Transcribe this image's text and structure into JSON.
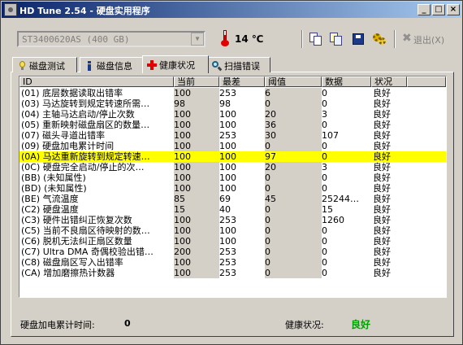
{
  "window": {
    "title": "HD Tune 2.54 - 硬盘实用程序",
    "minimize": "_",
    "maximize": "□",
    "close": "×"
  },
  "toolbar": {
    "drive": "ST3400620AS (400 GB)",
    "temperature": "14 ℃",
    "exit_label": "退出(X)"
  },
  "tabs": [
    {
      "label": "磁盘测试",
      "icon": "lightbulb-icon"
    },
    {
      "label": "磁盘信息",
      "icon": "info-icon"
    },
    {
      "label": "健康状况",
      "icon": "red-cross-icon",
      "active": true
    },
    {
      "label": "扫描错误",
      "icon": "magnifier-icon"
    }
  ],
  "table": {
    "columns": [
      "ID",
      "当前",
      "最差",
      "阈值",
      "数据",
      "状况"
    ],
    "rows": [
      {
        "id": "(01) 底层数据读取出错率",
        "cur": "100",
        "worst": "253",
        "thr": "6",
        "data": "0",
        "status": "良好"
      },
      {
        "id": "(03) 马达旋转到规定转速所需…",
        "cur": "98",
        "worst": "98",
        "thr": "0",
        "data": "0",
        "status": "良好"
      },
      {
        "id": "(04) 主轴马达启动/停止次数",
        "cur": "100",
        "worst": "100",
        "thr": "20",
        "data": "3",
        "status": "良好"
      },
      {
        "id": "(05) 重新映射磁盘扇区的数量…",
        "cur": "100",
        "worst": "100",
        "thr": "36",
        "data": "0",
        "status": "良好"
      },
      {
        "id": "(07) 磁头寻道出错率",
        "cur": "100",
        "worst": "253",
        "thr": "30",
        "data": "107",
        "status": "良好"
      },
      {
        "id": "(09) 硬盘加电累计时间",
        "cur": "100",
        "worst": "100",
        "thr": "0",
        "data": "0",
        "status": "良好"
      },
      {
        "id": "(0A) 马达重新旋转到规定转速…",
        "cur": "100",
        "worst": "100",
        "thr": "97",
        "data": "0",
        "status": "良好",
        "selected": true
      },
      {
        "id": "(0C) 硬盘完全启动/停止的次…",
        "cur": "100",
        "worst": "100",
        "thr": "20",
        "data": "3",
        "status": "良好"
      },
      {
        "id": "(BB) (未知属性)",
        "cur": "100",
        "worst": "100",
        "thr": "0",
        "data": "0",
        "status": "良好"
      },
      {
        "id": "(BD) (未知属性)",
        "cur": "100",
        "worst": "100",
        "thr": "0",
        "data": "0",
        "status": "良好"
      },
      {
        "id": "(BE) 气流温度",
        "cur": "85",
        "worst": "69",
        "thr": "45",
        "data": "25244…",
        "status": "良好"
      },
      {
        "id": "(C2) 硬盘温度",
        "cur": "15",
        "worst": "40",
        "thr": "0",
        "data": "15",
        "status": "良好"
      },
      {
        "id": "(C3) 硬件出错纠正恢复次数",
        "cur": "100",
        "worst": "253",
        "thr": "0",
        "data": "1260",
        "status": "良好"
      },
      {
        "id": "(C5) 当前不良扇区待映射的数…",
        "cur": "100",
        "worst": "100",
        "thr": "0",
        "data": "0",
        "status": "良好"
      },
      {
        "id": "(C6) 脱机无法纠正扇区数量",
        "cur": "100",
        "worst": "100",
        "thr": "0",
        "data": "0",
        "status": "良好"
      },
      {
        "id": "(C7) Ultra DMA 奇偶校验出错…",
        "cur": "200",
        "worst": "253",
        "thr": "0",
        "data": "0",
        "status": "良好"
      },
      {
        "id": "(C8) 磁盘扇区写入出错率",
        "cur": "100",
        "worst": "253",
        "thr": "0",
        "data": "0",
        "status": "良好"
      },
      {
        "id": "(CA) 增加磨擦热计数器",
        "cur": "100",
        "worst": "253",
        "thr": "0",
        "data": "0",
        "status": "良好"
      }
    ]
  },
  "footer": {
    "power_on_label": "硬盘加电累计时间:",
    "power_on_value": "0",
    "health_label": "健康状况:",
    "health_value": "良好"
  },
  "colors": {
    "selected_row": "#ffff00",
    "health_good": "#00a000",
    "title_bar": "#0a246a"
  }
}
